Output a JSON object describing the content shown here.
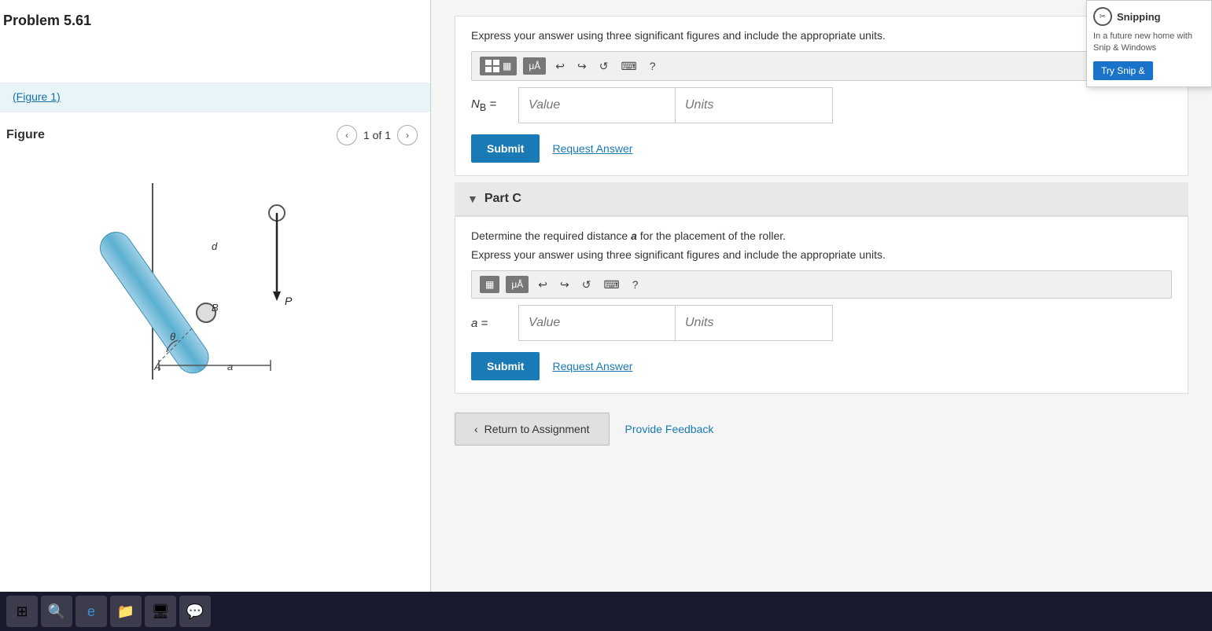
{
  "snip": {
    "title": "Snipping",
    "body": "In a future new home with Snip & Windows",
    "try_btn": "Try Snip &"
  },
  "problem": {
    "title": "Problem 5.61"
  },
  "figure_label": {
    "text": "(Figure 1)"
  },
  "figure": {
    "title": "Figure",
    "nav_count": "1 of 1"
  },
  "partB": {
    "instruction": "Express your answer using three significant figures and include the appropriate units.",
    "label": "N",
    "subscript": "B",
    "equals": "=",
    "value_placeholder": "Value",
    "units_placeholder": "Units",
    "submit_label": "Submit",
    "request_label": "Request Answer"
  },
  "partC": {
    "title": "Part C",
    "description": "Determine the required distance",
    "variable": "a",
    "description_end": "for the placement of the roller.",
    "instruction": "Express your answer using three significant figures and include the appropriate units.",
    "label": "a",
    "equals": "=",
    "value_placeholder": "Value",
    "units_placeholder": "Units",
    "submit_label": "Submit",
    "request_label": "Request Answer"
  },
  "footer": {
    "return_label": "Return to Assignment",
    "feedback_label": "Provide Feedback"
  }
}
